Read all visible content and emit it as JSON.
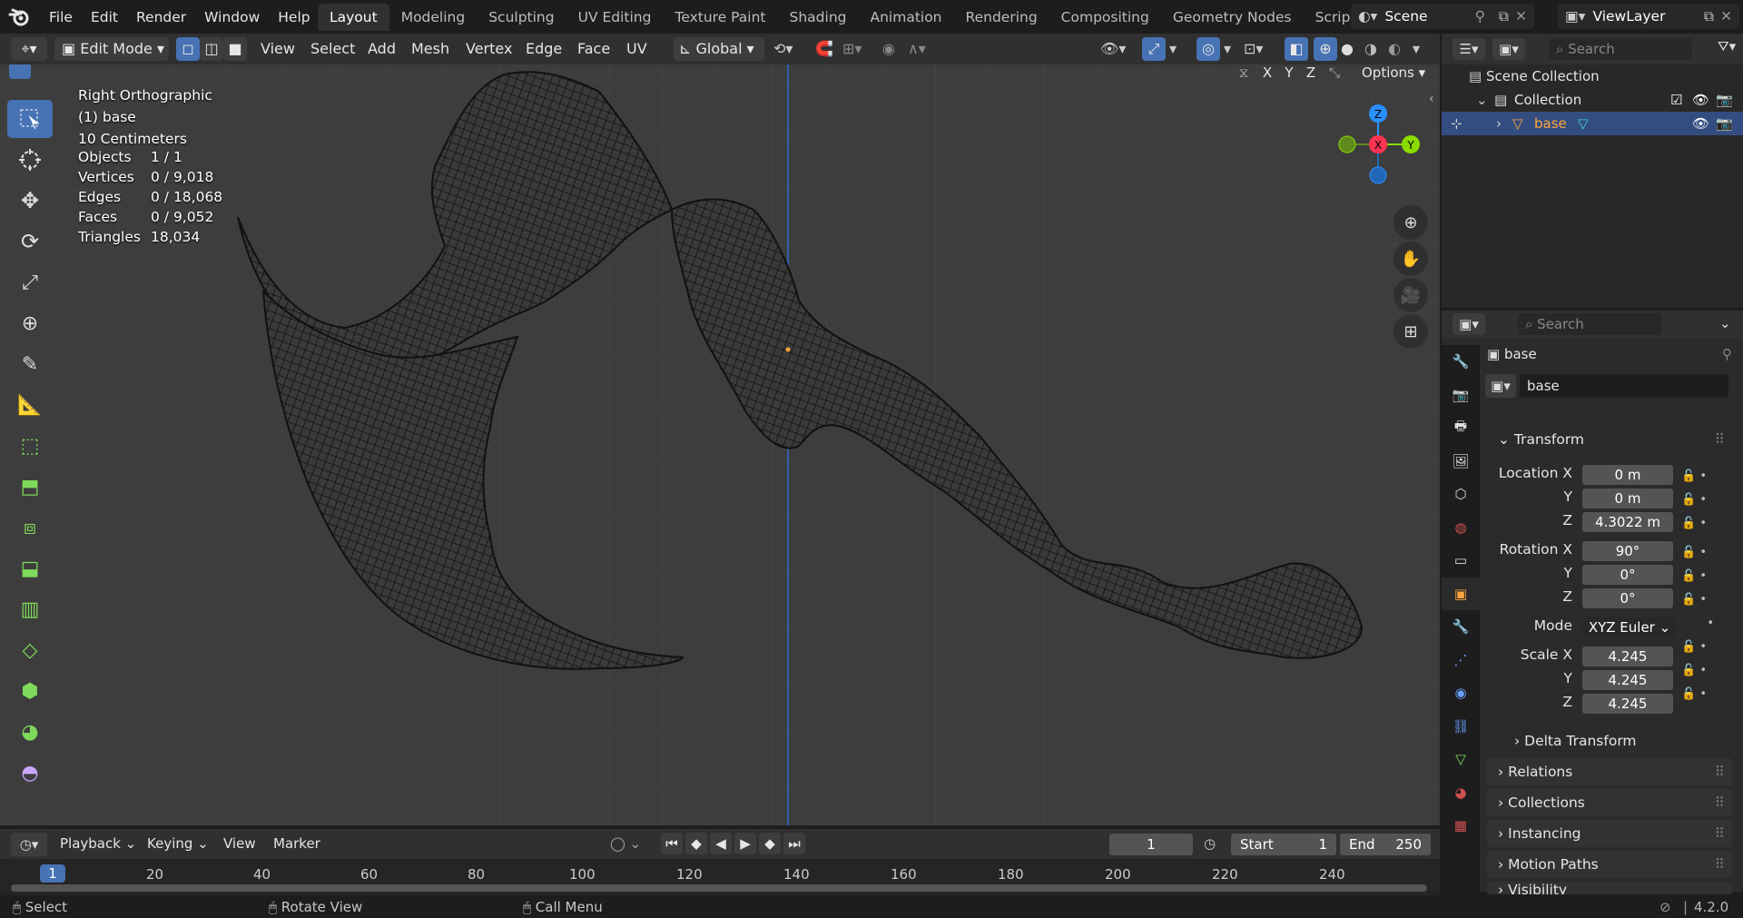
{
  "menu": {
    "items": [
      "File",
      "Edit",
      "Render",
      "Window",
      "Help"
    ]
  },
  "workspaces": [
    "Layout",
    "Modeling",
    "Sculpting",
    "UV Editing",
    "Texture Paint",
    "Shading",
    "Animation",
    "Rendering",
    "Compositing",
    "Geometry Nodes",
    "Scripting"
  ],
  "active_workspace": "Layout",
  "scene": {
    "name": "Scene",
    "view_layer": "ViewLayer"
  },
  "viewport_header": {
    "mode": "Edit Mode",
    "menus": [
      "View",
      "Select",
      "Add",
      "Mesh",
      "Vertex",
      "Edge",
      "Face",
      "UV"
    ],
    "transform_orientation": "Global",
    "options_label": "Options",
    "axis_toggles": [
      "X",
      "Y",
      "Z"
    ]
  },
  "viewport_info": {
    "view_name": "Right Orthographic",
    "object": "(1) base",
    "scale": "10 Centimeters",
    "stats": [
      {
        "label": "Objects",
        "value": "1 / 1"
      },
      {
        "label": "Vertices",
        "value": "0 / 9,018"
      },
      {
        "label": "Edges",
        "value": "0 / 18,068"
      },
      {
        "label": "Faces",
        "value": "0 / 9,052"
      },
      {
        "label": "Triangles",
        "value": "18,034"
      }
    ]
  },
  "gizmo": {
    "z": "Z",
    "x": "X",
    "y": "Y"
  },
  "outliner": {
    "search_placeholder": "Search",
    "scene_collection": "Scene Collection",
    "collection": "Collection",
    "object": "base"
  },
  "properties": {
    "search_placeholder": "Search",
    "object_name": "base",
    "data_name": "base",
    "transform_label": "Transform",
    "location": {
      "label": "Location X",
      "x": "0 m",
      "y": "0 m",
      "z": "4.3022 m"
    },
    "rotation": {
      "label": "Rotation X",
      "x": "90°",
      "y": "0°",
      "z": "0°"
    },
    "mode": {
      "label": "Mode",
      "value": "XYZ Euler"
    },
    "scale": {
      "label": "Scale X",
      "x": "4.245",
      "y": "4.245",
      "z": "4.245"
    },
    "axis_y": "Y",
    "axis_z": "Z",
    "sections": [
      "Delta Transform",
      "Relations",
      "Collections",
      "Instancing",
      "Motion Paths",
      "Visibility"
    ]
  },
  "timeline": {
    "menus": [
      "Playback",
      "Keying",
      "View",
      "Marker"
    ],
    "current_frame": "1",
    "start_label": "Start",
    "start": "1",
    "end_label": "End",
    "end": "250",
    "ruler": [
      "1",
      "20",
      "40",
      "60",
      "80",
      "100",
      "120",
      "140",
      "160",
      "180",
      "200",
      "220",
      "240"
    ]
  },
  "statusbar": {
    "select": "Select",
    "rotate": "Rotate View",
    "call_menu": "Call Menu",
    "version": "4.2.0"
  },
  "colors": {
    "accent": "#4772b3",
    "x_axis": "#ff3352",
    "y_axis": "#8bdc00",
    "z_axis": "#2890ff",
    "object_orange": "#ffa33d"
  }
}
